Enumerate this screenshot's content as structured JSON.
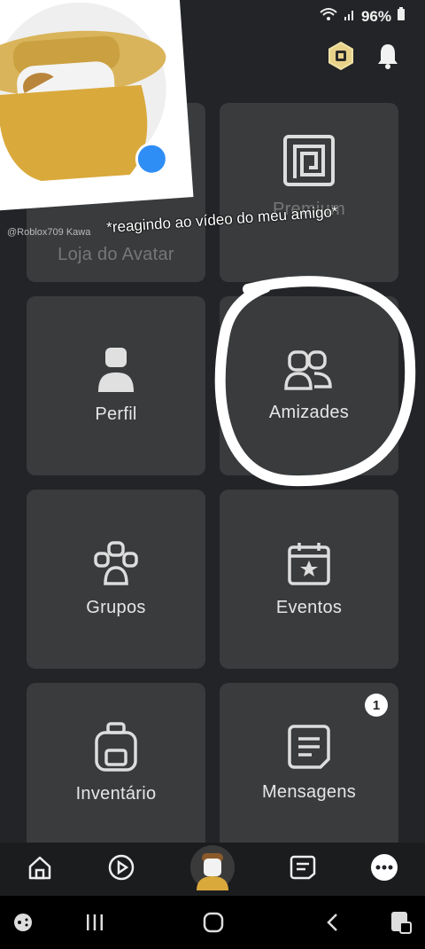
{
  "status": {
    "battery": "96%"
  },
  "tiles": [
    {
      "id": "avatar-shop",
      "label": "Loja do Avatar"
    },
    {
      "id": "premium",
      "label": "Premium"
    },
    {
      "id": "profile",
      "label": "Perfil"
    },
    {
      "id": "friends",
      "label": "Amizades"
    },
    {
      "id": "groups",
      "label": "Grupos"
    },
    {
      "id": "events",
      "label": "Eventos"
    },
    {
      "id": "inventory",
      "label": "Inventário"
    },
    {
      "id": "messages",
      "label": "Mensagens",
      "badge": "1"
    }
  ],
  "overlay": {
    "caption": "*reagindo ao vídeo do meu amigo*",
    "handle": "@Roblox709 Kawa"
  },
  "colors": {
    "tile": "#393b3d",
    "bg": "#232427",
    "accent": "#2f8ef5"
  }
}
